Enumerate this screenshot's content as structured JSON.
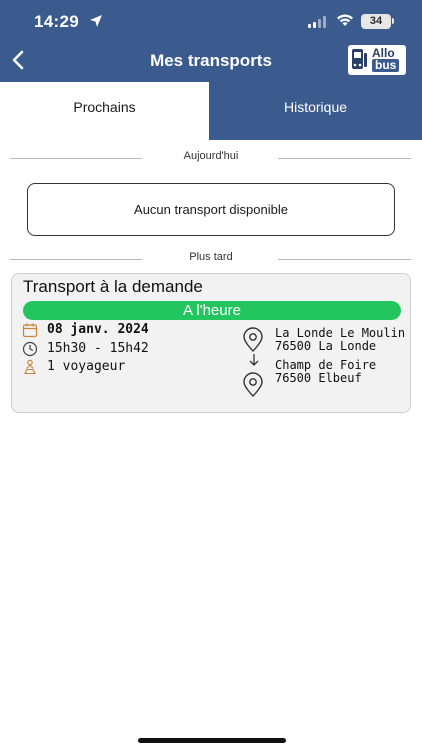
{
  "status_bar": {
    "time": "14:29",
    "battery": "34"
  },
  "nav": {
    "title": "Mes transports",
    "logo_line1": "Allo",
    "logo_line2": "bus"
  },
  "tabs": [
    {
      "label": "Prochains",
      "active": true
    },
    {
      "label": "Historique",
      "active": false
    }
  ],
  "sections": {
    "today": "Aujourd'hui",
    "later": "Plus tard",
    "empty_message": "Aucun transport disponible"
  },
  "trip": {
    "title": "Transport à la demande",
    "status": "A l'heure",
    "status_color": "#22c55e",
    "date": "08 janv. 2024",
    "time_range": "15h30 - 15h42",
    "passengers": "1 voyageur",
    "from_line1": "La Londe Le Moulin",
    "from_line2": "76500 La Londe",
    "to_line1": "Champ de Foire",
    "to_line2": "76500 Elbeuf"
  },
  "colors": {
    "header": "#3b5b8f",
    "accent_green": "#22c55e"
  }
}
